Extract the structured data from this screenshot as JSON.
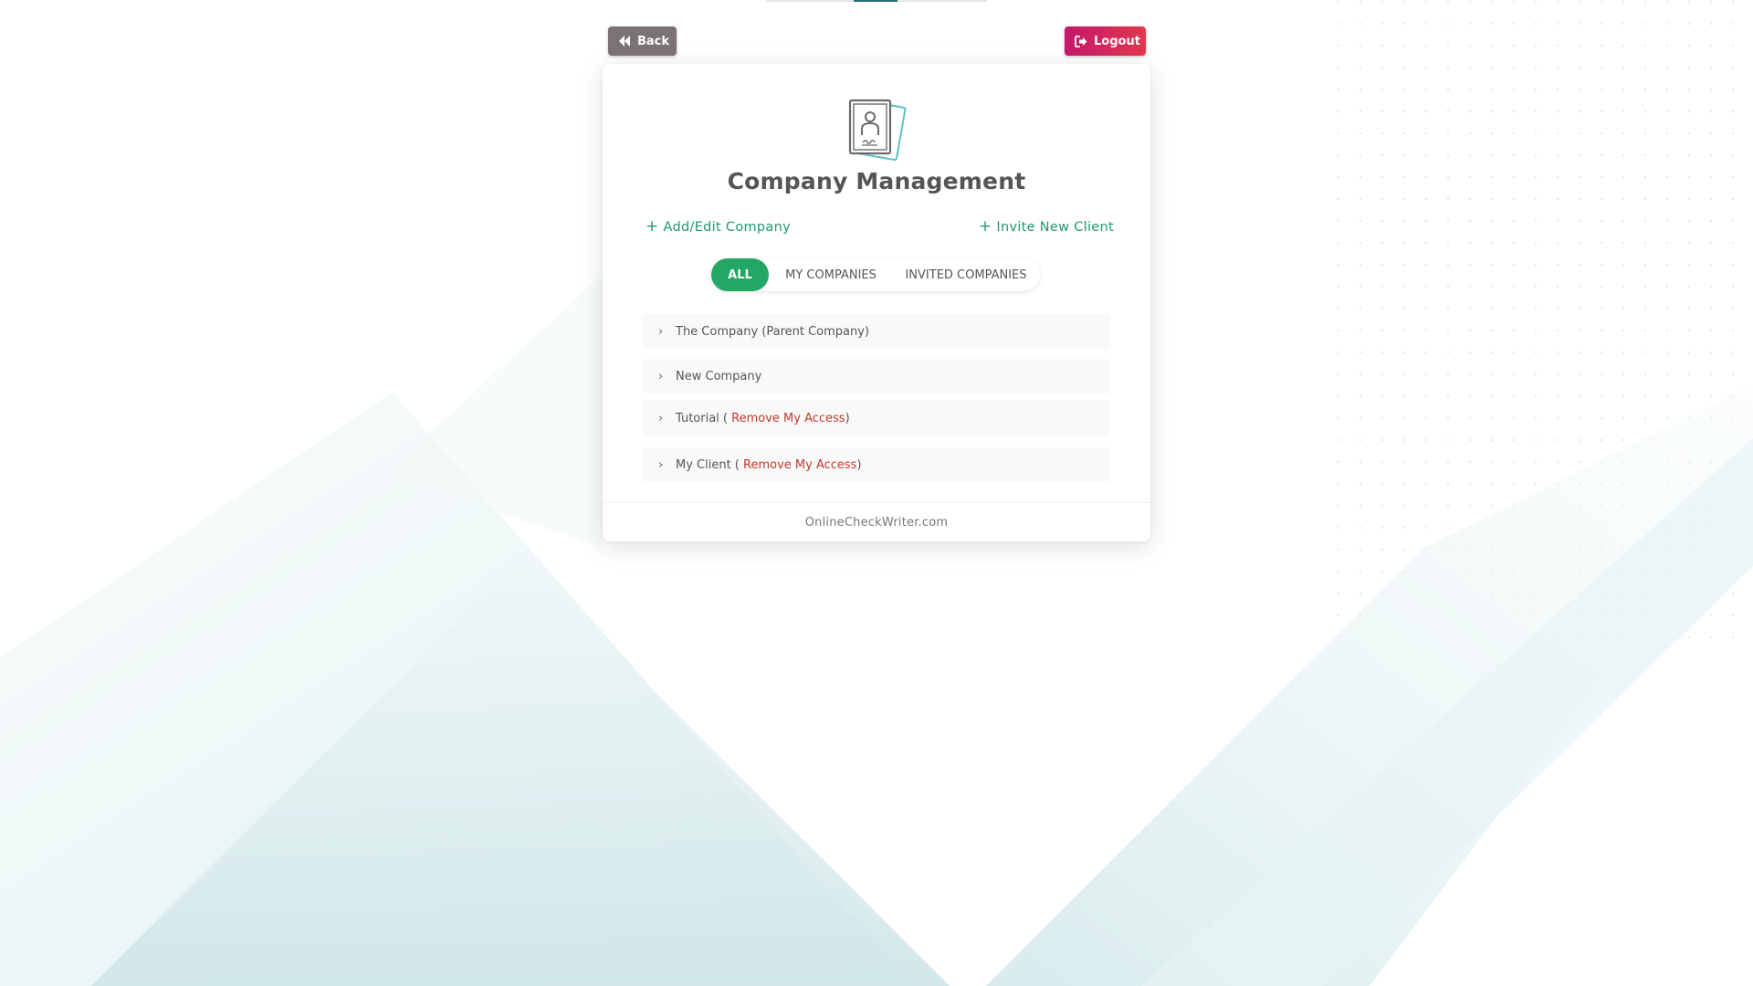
{
  "header": {
    "back_label": "Back",
    "logout_label": "Logout"
  },
  "card": {
    "title": "Company Management",
    "add_edit_label": "Add/Edit Company",
    "invite_label": "Invite New Client",
    "plus_glyph": "+",
    "chevron_glyph": "›",
    "tabs": [
      {
        "label": "ALL",
        "active": true
      },
      {
        "label": "MY COMPANIES",
        "active": false
      },
      {
        "label": "INVITED COMPANIES",
        "active": false
      }
    ],
    "companies": [
      {
        "prefix": "The Company (Parent Company)",
        "remove_label": "",
        "suffix": ""
      },
      {
        "prefix": "New Company",
        "remove_label": "",
        "suffix": ""
      },
      {
        "prefix": "Tutorial ( ",
        "remove_label": "Remove My Access",
        "suffix": ")"
      },
      {
        "prefix": "My Client ( ",
        "remove_label": "Remove My Access",
        "suffix": ")"
      }
    ],
    "footer": "OnlineCheckWriter.com"
  },
  "colors": {
    "accent_green": "#23a765",
    "link_green": "#1f9a6e",
    "remove_red": "#c0392b",
    "back_button": "#7b7273",
    "logout_start": "#c4176c",
    "logout_end": "#e0384d"
  },
  "icons": {
    "back": "double-chevron-left-icon",
    "logout": "sign-out-icon",
    "company": "id-card-profile-icon",
    "add": "plus-icon",
    "expand": "chevron-right-icon"
  }
}
